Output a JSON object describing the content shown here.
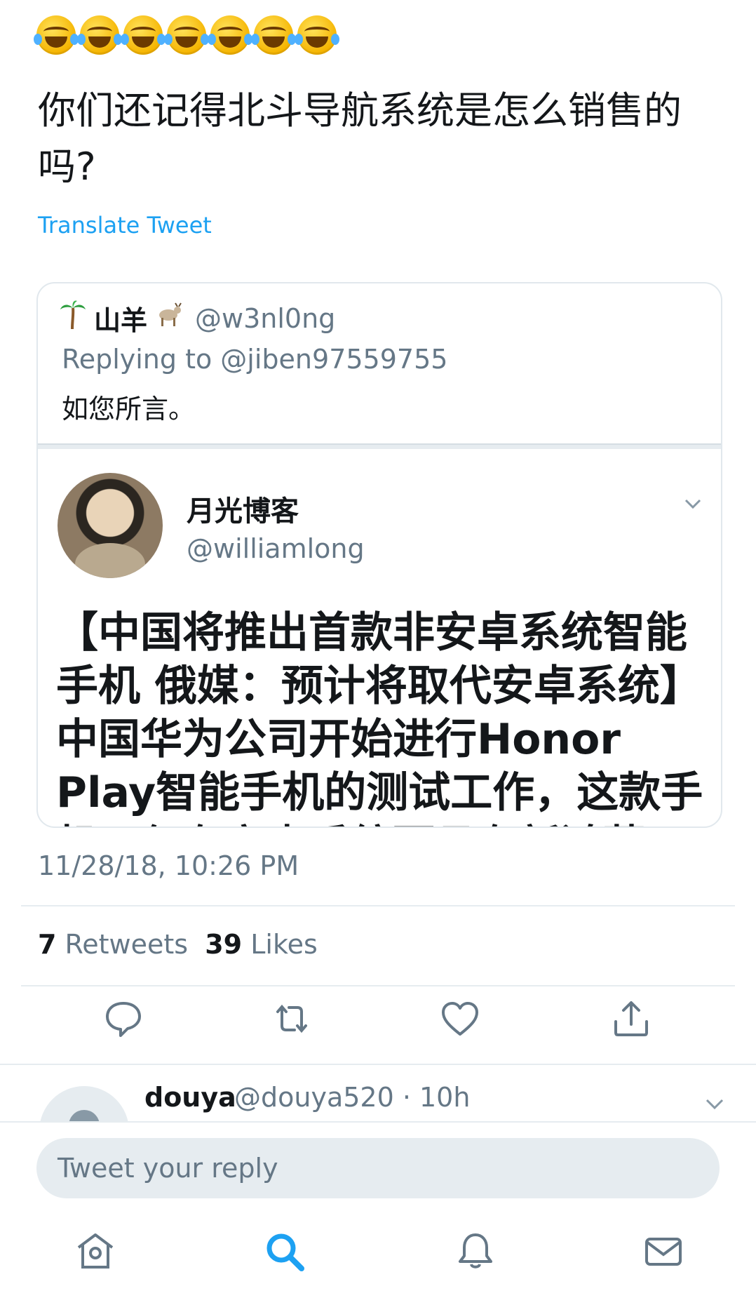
{
  "tweet": {
    "emoji": [
      "😂",
      "😂",
      "😂",
      "😂",
      "😂",
      "😂",
      "😂"
    ],
    "text": "你们还记得北斗导航系统是怎么销售的吗?",
    "translate_label": "Translate Tweet",
    "timestamp": "11/28/18, 10:26 PM",
    "retweets_count": "7",
    "retweets_label": "Retweets",
    "likes_count": "39",
    "likes_label": "Likes"
  },
  "quoted": {
    "name": "山羊",
    "handle": "@w3nl0ng",
    "replying_to": "Replying to @jiben97559755",
    "body": "如您所言。",
    "embedded": {
      "name": "月光博客",
      "handle": "@williamlong",
      "text": "【中国将推出首款非安卓系统智能手机 俄媒：预计将取代安卓系统】中国华为公司开始进行Honor Play智能手机的测试工作，这款手机不仅有安卓系统而且有新鸿蒙"
    }
  },
  "actions": {
    "icons": [
      "reply-icon",
      "retweet-icon",
      "like-icon",
      "share-icon"
    ]
  },
  "reply": {
    "name": "douya",
    "meta": "@douya520 · 10h"
  },
  "compose": {
    "placeholder": "Tweet your reply"
  },
  "tabs": [
    "home-icon",
    "search-icon",
    "notifications-icon",
    "messages-icon"
  ],
  "colors": {
    "accent": "#1da1f2",
    "muted": "#657786",
    "text": "#14171a"
  }
}
